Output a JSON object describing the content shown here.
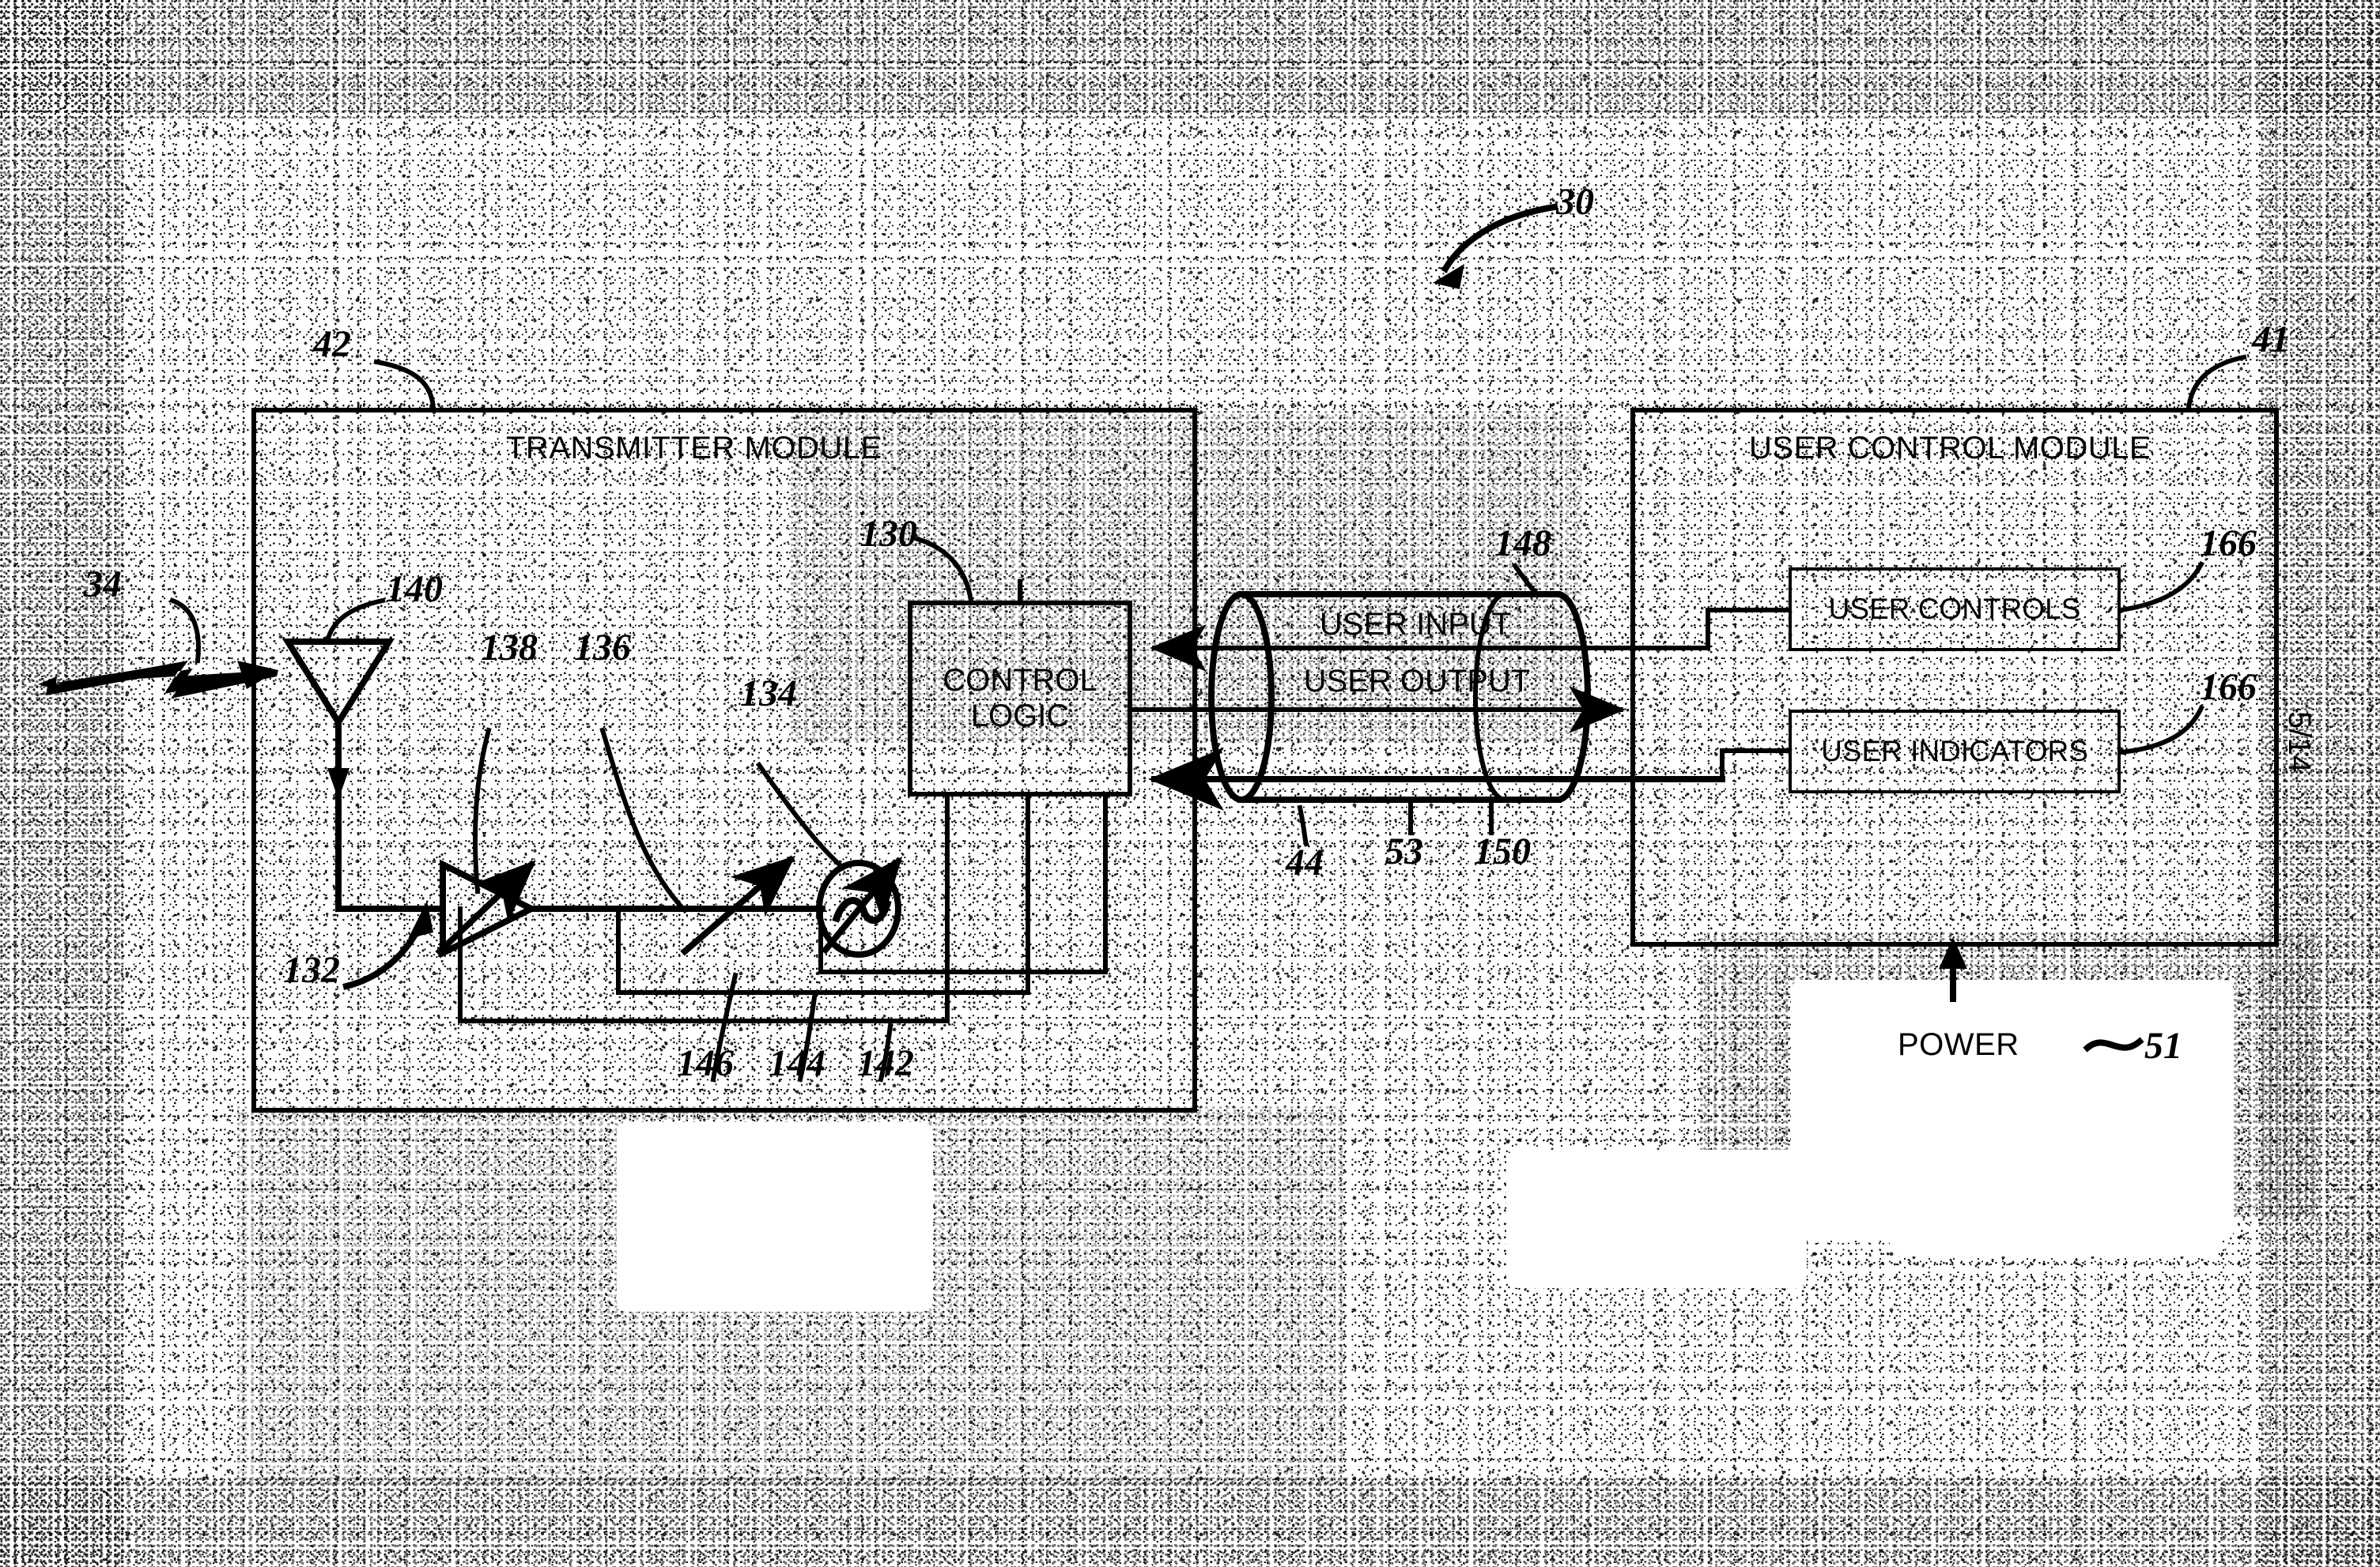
{
  "figure": {
    "page_marker": "5/14",
    "system_ref": "30"
  },
  "transmitter_module": {
    "title": "TRANSMITTER MODULE",
    "ref": "42",
    "control_logic": {
      "line1": "CONTROL",
      "line2": "LOGIC",
      "ref": "130"
    },
    "antenna": {
      "ref": "140"
    },
    "amplifier": {
      "ref": "138"
    },
    "attenuator": {
      "ref": "136"
    },
    "oscillator": {
      "ref": "134"
    },
    "rf_emission_ref": "34",
    "signal_path_ref": "132",
    "control_lines": [
      "146",
      "144",
      "142"
    ]
  },
  "interface": {
    "user_input": "USER INPUT",
    "user_output": "USER OUTPUT",
    "bus_ref": "148",
    "left_ref": "44",
    "mid_ref": "53",
    "right_ref": "150"
  },
  "user_control_module": {
    "title": "USER CONTROL MODULE",
    "ref": "41",
    "controls": {
      "label": "USER CONTROLS",
      "ref": "166"
    },
    "indicators": {
      "label": "USER INDICATORS",
      "ref": "166"
    },
    "power": {
      "label": "POWER",
      "ref": "51"
    }
  },
  "colors": {
    "ink": "#000000",
    "paper": "#ffffff"
  }
}
